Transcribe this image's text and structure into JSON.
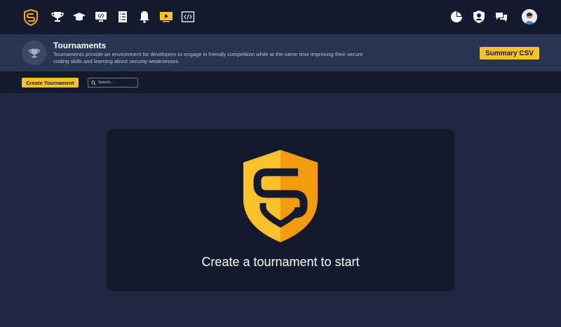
{
  "topbar": {
    "nav_items": [
      {
        "name": "trophy-icon"
      },
      {
        "name": "graduation-cap-icon"
      },
      {
        "name": "code-monitor-icon"
      },
      {
        "name": "checklist-icon"
      },
      {
        "name": "bell-icon"
      },
      {
        "name": "play-screen-icon",
        "active": true
      },
      {
        "name": "code-window-icon"
      }
    ],
    "right_items": [
      {
        "name": "pie-chart-icon"
      },
      {
        "name": "shield-user-icon"
      },
      {
        "name": "chat-bubbles-icon"
      }
    ]
  },
  "header": {
    "title": "Tournaments",
    "description": "Tournaments provide an environment for developers to engage in friendly competition while at the same time improving their secure coding skills and learning about security weaknesses.",
    "summary_button": "Summary CSV"
  },
  "toolbar": {
    "create_button": "Create Tournament",
    "search_placeholder": "Search..."
  },
  "empty_state": {
    "message": "Create a tournament to start"
  },
  "colors": {
    "accent": "#f6c12b",
    "topbar_bg": "#141b2e",
    "header_bg": "#283553",
    "page_bg": "#1e2841"
  }
}
